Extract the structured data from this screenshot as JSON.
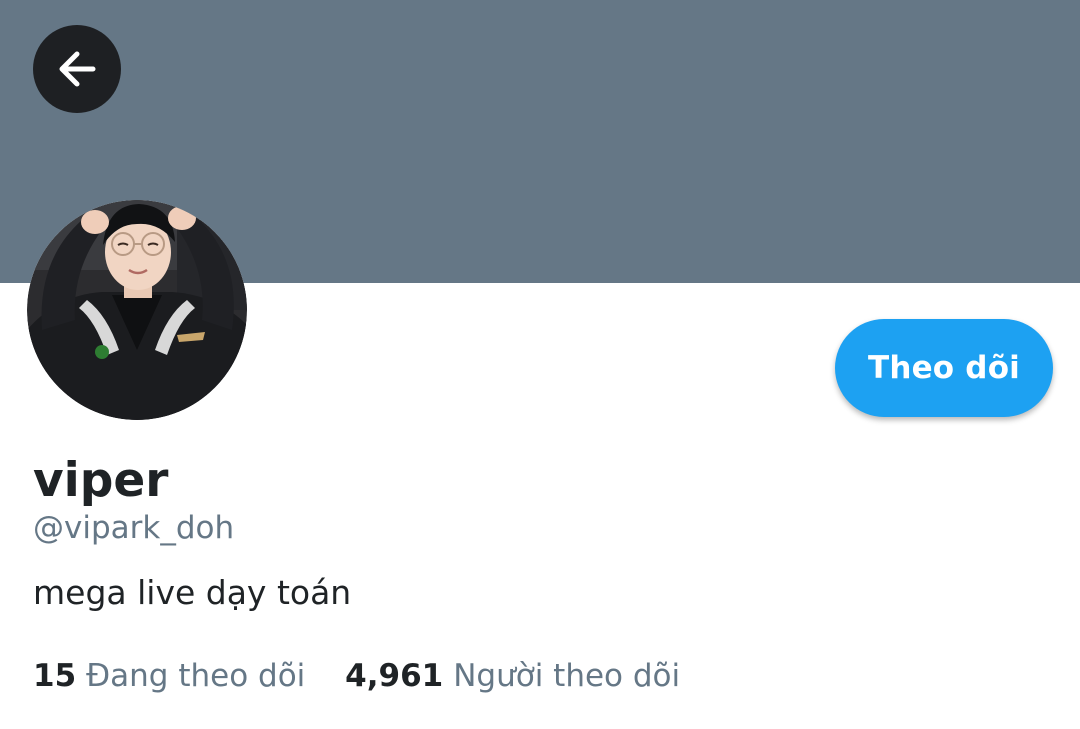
{
  "header": {
    "back_icon": "arrow-left-icon",
    "banner_color": "#657786"
  },
  "profile": {
    "avatar_icon": "profile-photo",
    "display_name": "viper",
    "handle": "@vipark_doh",
    "bio": "mega live dạy toán",
    "follow_label": "Theo dõi",
    "accent_color": "#1da1f2"
  },
  "stats": {
    "following_count": "15",
    "following_label": "Đang theo dõi",
    "followers_count": "4,961",
    "followers_label": "Người theo dõi"
  }
}
